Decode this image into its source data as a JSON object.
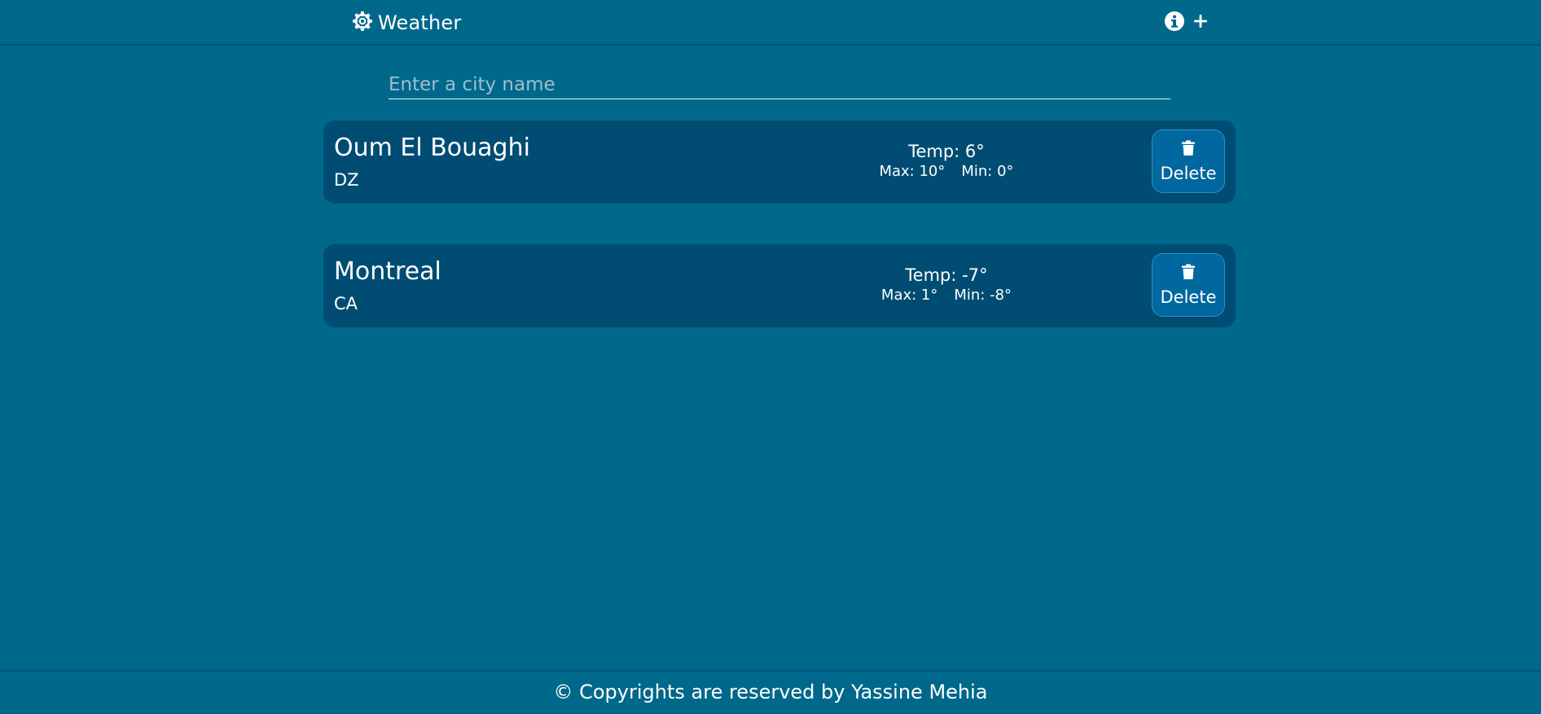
{
  "header": {
    "brand_icon": "gear-icon",
    "title": "Weather",
    "actions": [
      {
        "icon": "info-icon"
      },
      {
        "icon": "plus-icon"
      }
    ]
  },
  "search": {
    "placeholder": "Enter a city name",
    "value": ""
  },
  "cities": [
    {
      "name": "Oum El Bouaghi",
      "country": "DZ",
      "temp": "Temp: 6°",
      "max": "Max: 10°",
      "min": "Min: 0°",
      "delete_label": "Delete"
    },
    {
      "name": "Montreal",
      "country": "CA",
      "temp": "Temp: -7°",
      "max": "Max: 1°",
      "min": "Min: -8°",
      "delete_label": "Delete"
    }
  ],
  "footer": {
    "text": "© Copyrights are reserved by Yassine Mehia"
  },
  "colors": {
    "background": "#00688b",
    "card": "#004c73",
    "button": "#00679f",
    "text": "#ffffff"
  }
}
